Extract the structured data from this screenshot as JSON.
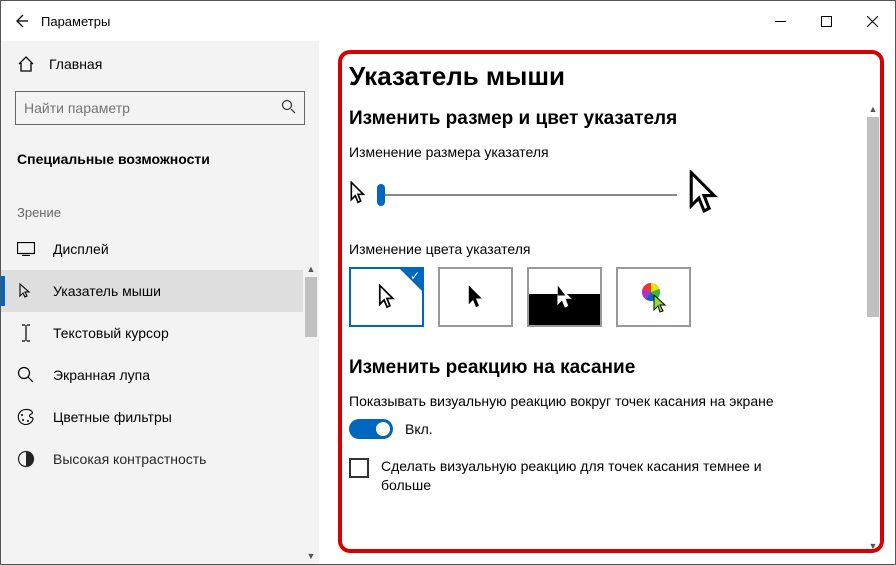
{
  "window": {
    "title": "Параметры"
  },
  "sidebar": {
    "home": "Главная",
    "search_placeholder": "Найти параметр",
    "section": "Специальные возможности",
    "group": "Зрение",
    "items": [
      {
        "label": "Дисплей"
      },
      {
        "label": "Указатель мыши"
      },
      {
        "label": "Текстовый курсор"
      },
      {
        "label": "Экранная лупа"
      },
      {
        "label": "Цветные фильтры"
      },
      {
        "label": "Высокая контрастность"
      }
    ]
  },
  "main": {
    "title": "Указатель мыши",
    "size_heading": "Изменить размер и цвет указателя",
    "size_label": "Изменение размера указателя",
    "color_label": "Изменение цвета указателя",
    "touch_heading": "Изменить реакцию на касание",
    "touch_desc": "Показывать визуальную реакцию вокруг точек касания на экране",
    "toggle_on": "Вкл.",
    "checkbox_label": "Сделать визуальную реакцию для точек касания темнее и больше"
  }
}
